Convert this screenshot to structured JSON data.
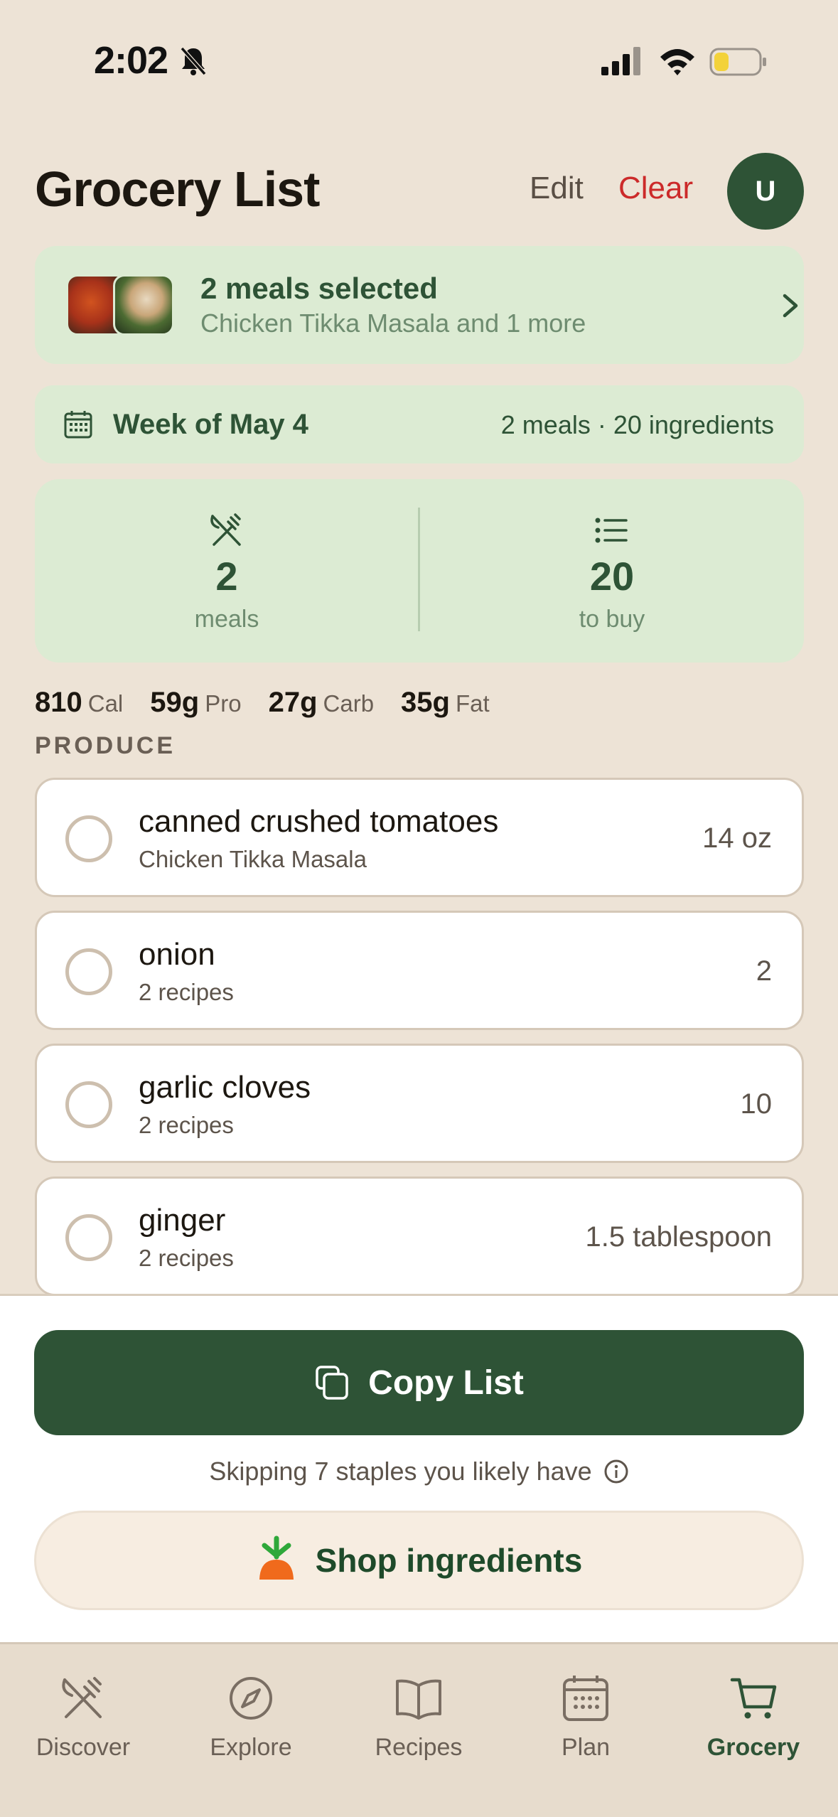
{
  "status_bar": {
    "time": "2:02"
  },
  "header": {
    "title": "Grocery List",
    "edit_label": "Edit",
    "clear_label": "Clear",
    "avatar_initial": "U"
  },
  "meals_card": {
    "title": "2 meals selected",
    "subtitle": "Chicken Tikka Masala and 1 more"
  },
  "week": {
    "label": "Week of May 4",
    "stats": "2 meals · 20 ingredients"
  },
  "stats": {
    "meals_value": "2",
    "meals_label": "meals",
    "buy_value": "20",
    "buy_label": "to buy"
  },
  "macros": [
    {
      "value": "810",
      "label": "Cal"
    },
    {
      "value": "59g",
      "label": "Pro"
    },
    {
      "value": "27g",
      "label": "Carb"
    },
    {
      "value": "35g",
      "label": "Fat"
    }
  ],
  "section": {
    "title": "PRODUCE"
  },
  "items": [
    {
      "name": "canned crushed tomatoes",
      "sub": "Chicken Tikka Masala",
      "qty": "14 oz"
    },
    {
      "name": "onion",
      "sub": "2 recipes",
      "qty": "2"
    },
    {
      "name": "garlic cloves",
      "sub": "2 recipes",
      "qty": "10"
    },
    {
      "name": "ginger",
      "sub": "2 recipes",
      "qty": "1.5 tablespoon"
    }
  ],
  "actions": {
    "copy_label": "Copy List",
    "skip_text": "Skipping 7 staples you likely have",
    "shop_label": "Shop ingredients"
  },
  "tabs": [
    {
      "label": "Discover",
      "icon": "utensils-icon"
    },
    {
      "label": "Explore",
      "icon": "compass-icon"
    },
    {
      "label": "Recipes",
      "icon": "book-icon"
    },
    {
      "label": "Plan",
      "icon": "calendar-icon"
    },
    {
      "label": "Grocery",
      "icon": "cart-icon",
      "active": true
    }
  ],
  "colors": {
    "primary": "#2e5336",
    "card": "#dcebd3",
    "background": "#ede3d6",
    "danger": "#cc2a2a"
  }
}
